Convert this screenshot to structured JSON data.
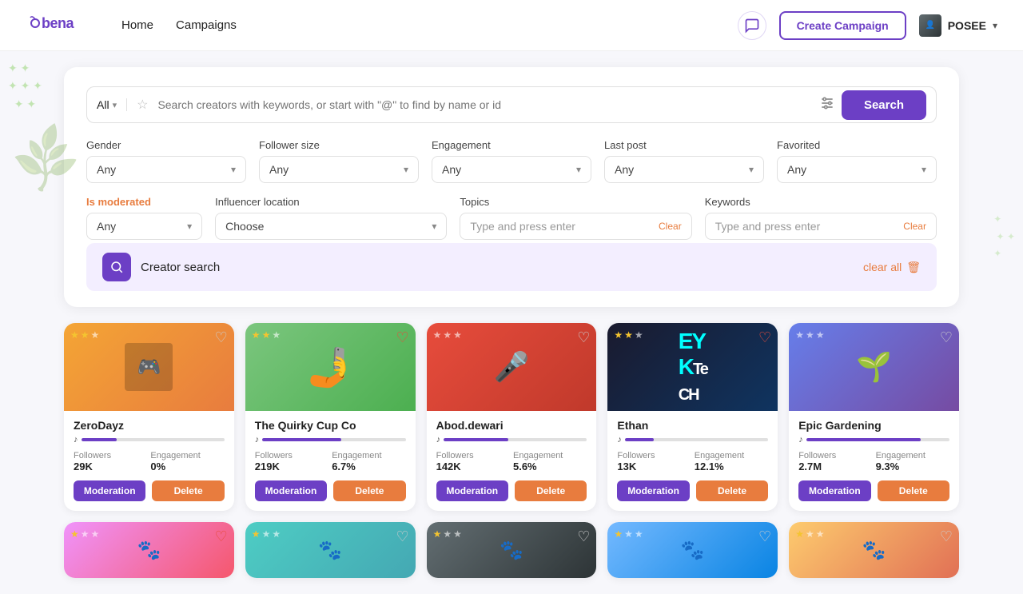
{
  "navbar": {
    "logo": "bena",
    "nav_items": [
      "Home",
      "Campaigns"
    ],
    "create_campaign": "Create Campaign",
    "user_name": "POSEE",
    "chat_icon": "💬"
  },
  "search": {
    "all_label": "All",
    "placeholder": "Search creators with keywords, or start with \"@\" to find by name or id",
    "search_btn": "Search"
  },
  "filters": {
    "gender": {
      "label": "Gender",
      "value": "Any"
    },
    "follower_size": {
      "label": "Follower size",
      "value": "Any"
    },
    "engagement": {
      "label": "Engagement",
      "value": "Any"
    },
    "last_post": {
      "label": "Last post",
      "value": "Any"
    },
    "favorited": {
      "label": "Favorited",
      "value": "Any"
    },
    "is_moderated": {
      "label": "Is moderated",
      "value": "Any"
    },
    "influencer_location": {
      "label": "Influencer location",
      "value": "Choose"
    },
    "topics": {
      "label": "Topics",
      "placeholder": "Type and press enter",
      "clear": "Clear"
    },
    "keywords": {
      "label": "Keywords",
      "placeholder": "Type and press enter",
      "clear": "Clear"
    }
  },
  "creator_search": {
    "label": "Creator search",
    "clear_all": "clear all"
  },
  "creators": [
    {
      "name": "ZeroDayz",
      "platform": "tiktok",
      "followers_label": "Followers",
      "followers": "29K",
      "engagement_label": "Engagement",
      "engagement": "0%",
      "stars": 2,
      "moderation_btn": "Moderation",
      "delete_btn": "Delete",
      "bg": "orange",
      "bar_pct": 25
    },
    {
      "name": "The Quirky Cup Co",
      "platform": "tiktok",
      "followers_label": "Followers",
      "followers": "219K",
      "engagement_label": "Engagement",
      "engagement": "6.7%",
      "stars": 2,
      "moderation_btn": "Moderation",
      "delete_btn": "Delete",
      "bg": "green",
      "bar_pct": 55,
      "has_heart": true
    },
    {
      "name": "Abod.dewari",
      "platform": "tiktok",
      "followers_label": "Followers",
      "followers": "142K",
      "engagement_label": "Engagement",
      "engagement": "5.6%",
      "stars": 0,
      "moderation_btn": "Moderation",
      "delete_btn": "Delete",
      "bg": "red",
      "bar_pct": 45
    },
    {
      "name": "Ethan",
      "platform": "tiktok",
      "followers_label": "Followers",
      "followers": "13K",
      "engagement_label": "Engagement",
      "engagement": "12.1%",
      "stars": 2,
      "moderation_btn": "Moderation",
      "delete_btn": "Delete",
      "bg": "dark",
      "bar_pct": 20,
      "has_heart": true
    },
    {
      "name": "Epic Gardening",
      "platform": "tiktok",
      "followers_label": "Followers",
      "followers": "2.7M",
      "engagement_label": "Engagement",
      "engagement": "9.3%",
      "stars": 0,
      "moderation_btn": "Moderation",
      "delete_btn": "Delete",
      "bg": "photo",
      "bar_pct": 80
    }
  ],
  "bottom_cards": [
    {
      "bg": "warm",
      "stars": 1,
      "has_heart": true
    },
    {
      "bg": "teal",
      "stars": 1,
      "has_heart": false
    },
    {
      "bg": "gray",
      "stars": 1,
      "has_heart": false
    },
    {
      "bg": "blue",
      "stars": 1,
      "has_heart": false
    },
    {
      "bg": "yellow",
      "stars": 1,
      "has_heart": false
    }
  ]
}
